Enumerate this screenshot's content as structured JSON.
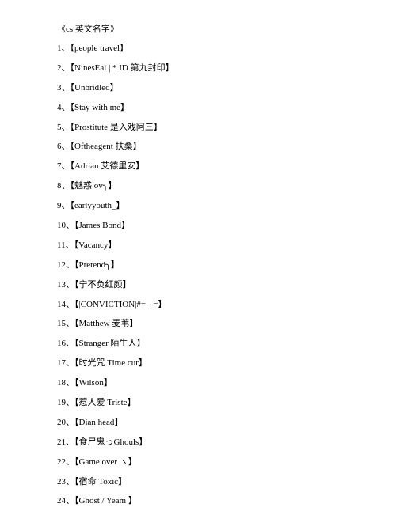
{
  "title": "《cs 英文名字》",
  "items": [
    "1、【people travel】",
    "2、【NinesEal | * ID 第九封印】",
    "3、【Unbridled】",
    "4、【Stay with me】",
    "5、【Prostitute 是入戏阿三】",
    "6、【Oftheagent 扶桑】",
    "7、【Adrian 艾德里安】",
    "8、【魅惑 ov╮】",
    "9、【earlyyouth_】",
    "10、【James Bond】",
    "11、【Vacancy】",
    "12、【Pretend╮】",
    "13、【宁不负红颜】",
    "14、【|CONVICTION|#=_-=】",
    "15、【Matthew 麦苇】",
    "16、【Stranger 陌生人】",
    "17、【时光咒 Time cur】",
    "18、【Wilson】",
    "19、【惹人爱 Triste】",
    "20、【Dian head】",
    "21、【食尸鬼っGhouls】",
    "22、【Game over ヽ】",
    "23、【宿命 Toxic】",
    "24、【Ghost / Yeam 】"
  ]
}
